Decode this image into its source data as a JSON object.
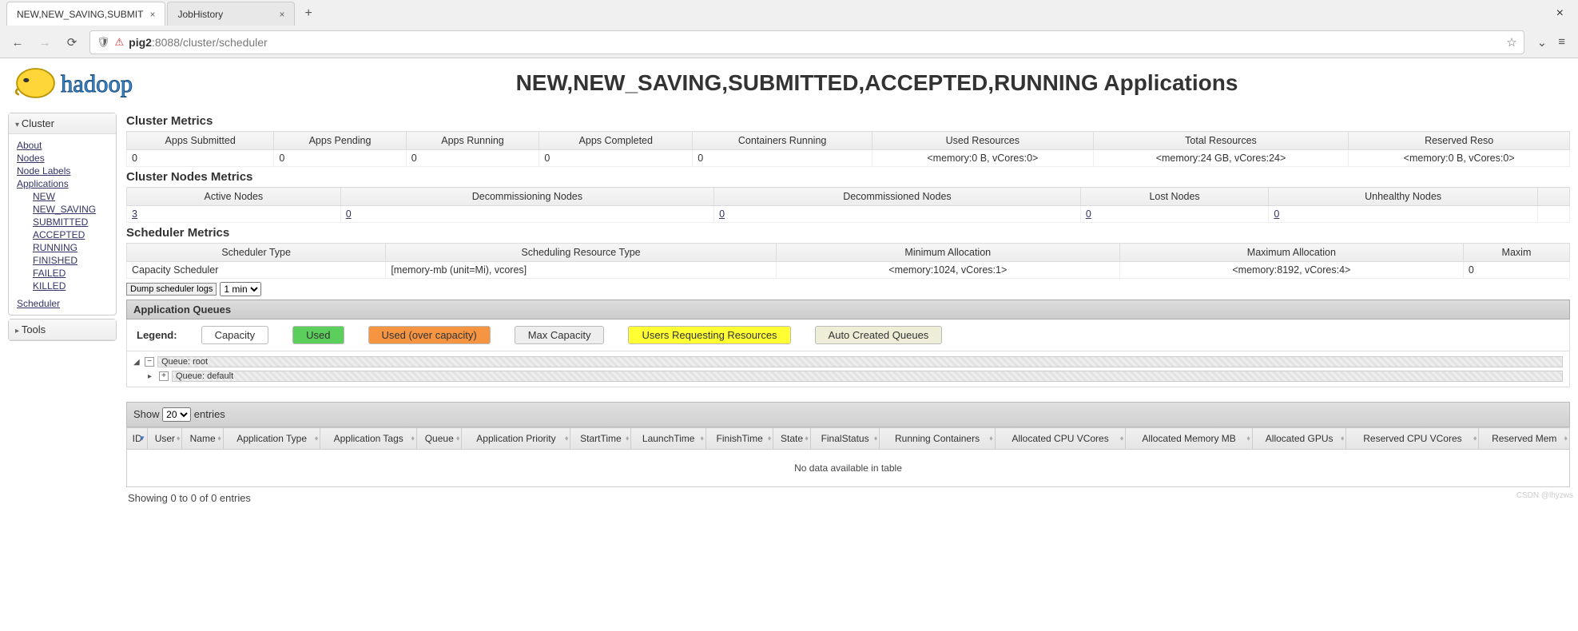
{
  "browser": {
    "tabs": [
      {
        "title": "NEW,NEW_SAVING,SUBMIT"
      },
      {
        "title": "JobHistory"
      }
    ],
    "url_host": "pig2",
    "url_path": ":8088/cluster/scheduler"
  },
  "page_title": "NEW,NEW_SAVING,SUBMITTED,ACCEPTED,RUNNING Applications",
  "sidebar": {
    "cluster_label": "Cluster",
    "tools_label": "Tools",
    "links": {
      "about": "About",
      "nodes": "Nodes",
      "node_labels": "Node Labels",
      "applications": "Applications",
      "new": "NEW",
      "new_saving": "NEW_SAVING",
      "submitted": "SUBMITTED",
      "accepted": "ACCEPTED",
      "running": "RUNNING",
      "finished": "FINISHED",
      "failed": "FAILED",
      "killed": "KILLED",
      "scheduler": "Scheduler"
    }
  },
  "sections": {
    "cluster_metrics": "Cluster Metrics",
    "cluster_nodes_metrics": "Cluster Nodes Metrics",
    "scheduler_metrics": "Scheduler Metrics",
    "application_queues": "Application Queues"
  },
  "cluster_metrics": {
    "headers": [
      "Apps Submitted",
      "Apps Pending",
      "Apps Running",
      "Apps Completed",
      "Containers Running",
      "Used Resources",
      "Total Resources",
      "Reserved Reso"
    ],
    "values": [
      "0",
      "0",
      "0",
      "0",
      "0",
      "<memory:0 B, vCores:0>",
      "<memory:24 GB, vCores:24>",
      "<memory:0 B, vCores:0>"
    ]
  },
  "nodes_metrics": {
    "headers": [
      "Active Nodes",
      "Decommissioning Nodes",
      "Decommissioned Nodes",
      "Lost Nodes",
      "Unhealthy Nodes",
      ""
    ],
    "values": [
      "3",
      "0",
      "0",
      "0",
      "0",
      ""
    ]
  },
  "scheduler_metrics": {
    "headers": [
      "Scheduler Type",
      "Scheduling Resource Type",
      "Minimum Allocation",
      "Maximum Allocation",
      "Maxim"
    ],
    "values": [
      "Capacity Scheduler",
      "[memory-mb (unit=Mi), vcores]",
      "<memory:1024, vCores:1>",
      "<memory:8192, vCores:4>",
      "0"
    ]
  },
  "dump": {
    "button": "Dump scheduler logs",
    "select_value": "1 min"
  },
  "legend": {
    "label": "Legend:",
    "capacity": "Capacity",
    "used": "Used",
    "over": "Used (over capacity)",
    "max": "Max Capacity",
    "users": "Users Requesting Resources",
    "auto": "Auto Created Queues"
  },
  "queues": {
    "root_label": "Queue: root",
    "default_label": "Queue: default"
  },
  "entries": {
    "show": "Show",
    "entries": "entries",
    "value": "20"
  },
  "apps_table": {
    "headers": [
      "ID",
      "User",
      "Name",
      "Application Type",
      "Application Tags",
      "Queue",
      "Application Priority",
      "StartTime",
      "LaunchTime",
      "FinishTime",
      "State",
      "FinalStatus",
      "Running Containers",
      "Allocated CPU VCores",
      "Allocated Memory MB",
      "Allocated GPUs",
      "Reserved CPU VCores",
      "Reserved Mem"
    ],
    "no_data": "No data available in table"
  },
  "showing": "Showing 0 to 0 of 0 entries",
  "watermark": "CSDN @lhyzws"
}
